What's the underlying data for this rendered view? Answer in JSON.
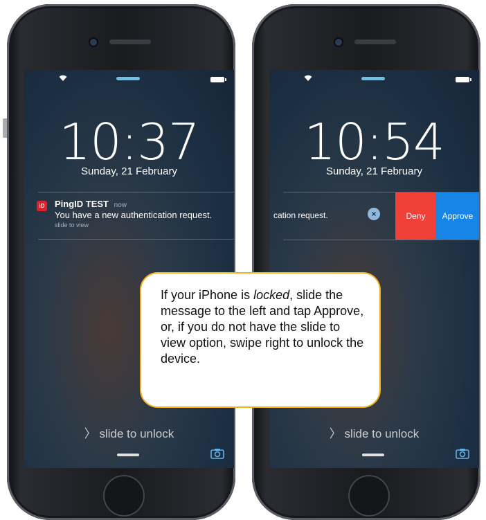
{
  "left_phone": {
    "time": "10:37",
    "date": "Sunday, 21 February",
    "notification": {
      "app_icon_text": "iD",
      "app_name": "PingID TEST",
      "time": "now",
      "message": "You have a new authentication request.",
      "hint": "slide to view"
    },
    "slide_unlock": "slide to unlock"
  },
  "right_phone": {
    "time": "10:54",
    "date": "Sunday, 21 February",
    "swiped_notification": {
      "message_tail": "cation request.",
      "clear_symbol": "×",
      "deny_label": "Deny",
      "approve_label": "Approve"
    },
    "slide_unlock": "slide to unlock"
  },
  "callout": {
    "before": "If your iPhone is ",
    "emphasis": "locked",
    "after": ", slide the message to the left and tap Approve, or, if you do not have the slide to view option, swipe right to unlock the device."
  },
  "colors": {
    "deny": "#f04138",
    "approve": "#1785e8",
    "callout_border": "#f2b21b",
    "app_icon": "#e0202d"
  },
  "icons": [
    "wifi-icon",
    "battery-icon",
    "camera-icon",
    "clear-icon",
    "chevron-right-icon"
  ]
}
